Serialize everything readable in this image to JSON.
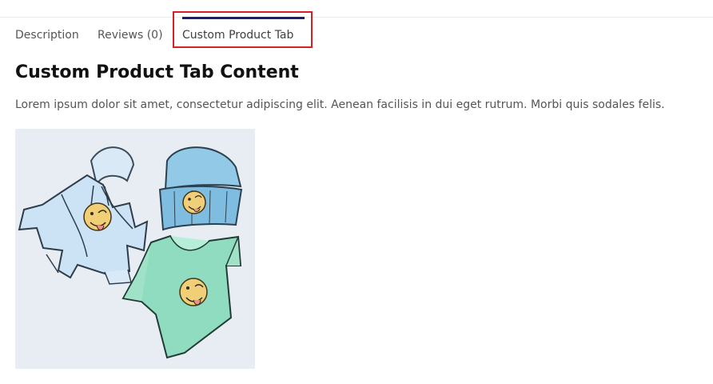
{
  "tabs": [
    {
      "label": "Description",
      "active": false
    },
    {
      "label": "Reviews (0)",
      "active": false
    },
    {
      "label": "Custom Product Tab",
      "active": true
    }
  ],
  "content": {
    "heading": "Custom Product Tab Content",
    "paragraph": "Lorem ipsum dolor sit amet, consectetur adipiscing elit. Aenean facilisis in dui eget rutrum. Morbi quis sodales felis."
  },
  "colors": {
    "active_tab_indicator": "#151f73",
    "highlight_box": "#d71f27",
    "heading_text": "#111111",
    "body_text": "#555555"
  },
  "image": {
    "items": [
      "hoodie",
      "beanie",
      "t-shirt"
    ]
  }
}
